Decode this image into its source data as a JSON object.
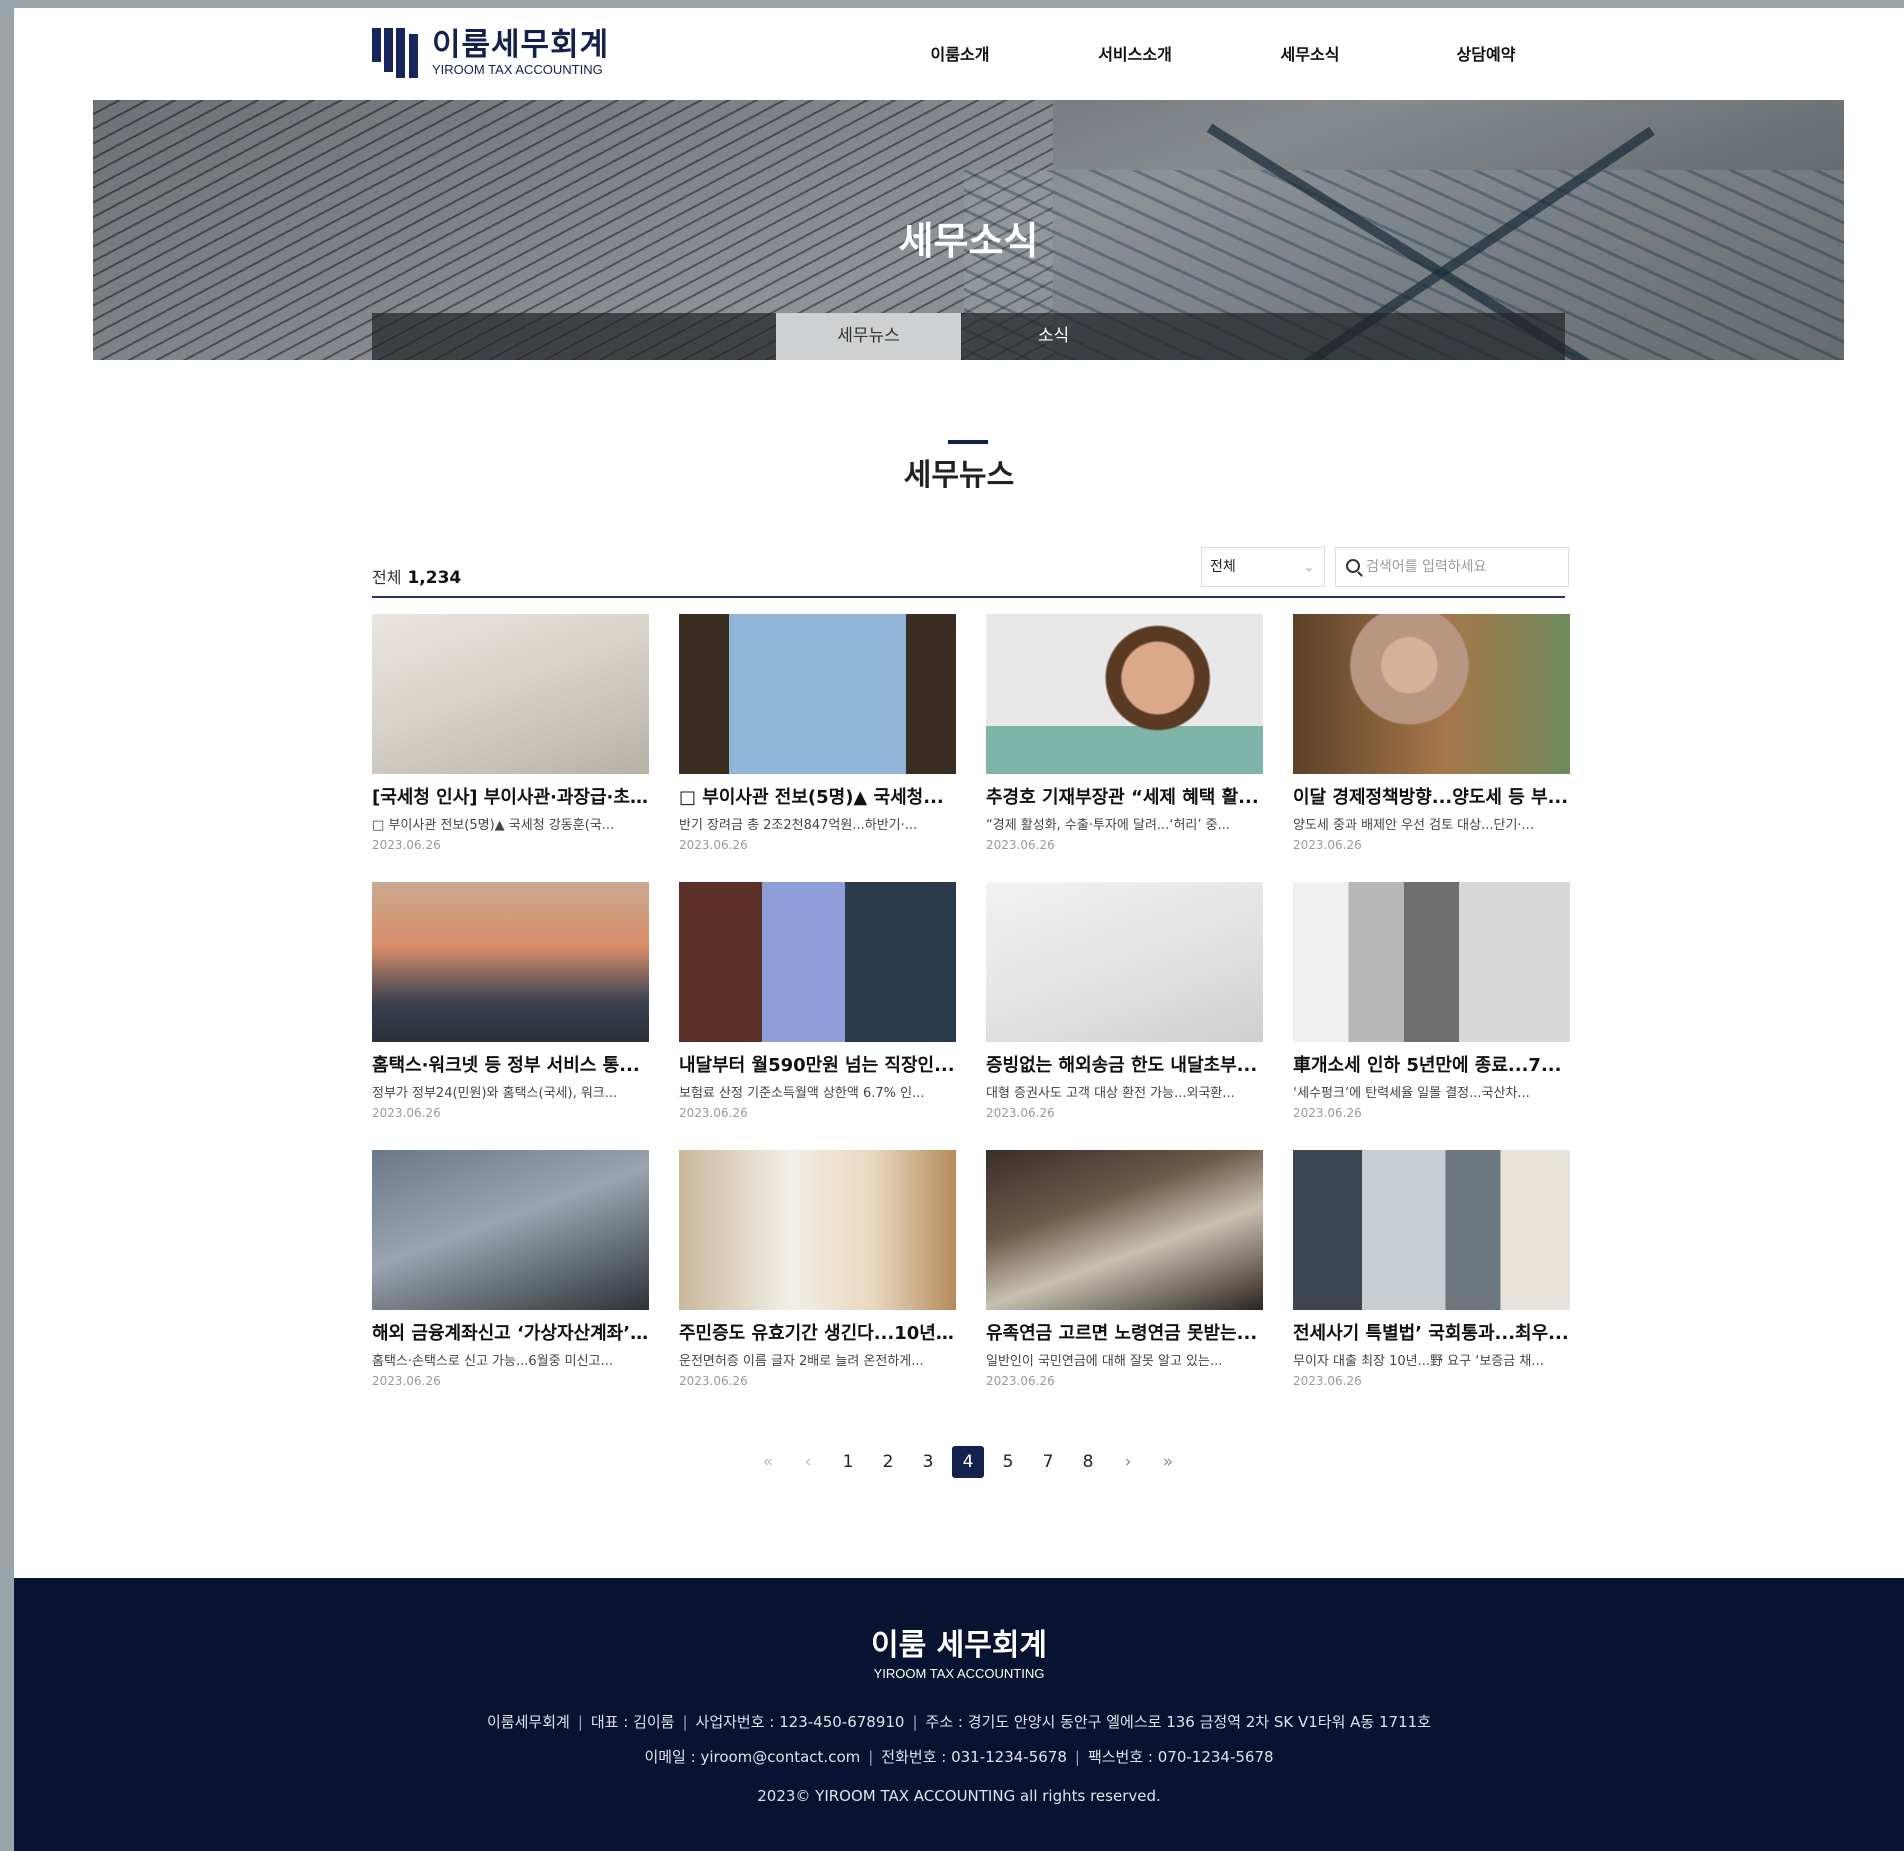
{
  "brand": {
    "name_ko": "이룸세무회계",
    "name_en": "YIROOM TAX ACCOUNTING",
    "color": "#15214d"
  },
  "nav": [
    "이룸소개",
    "서비스소개",
    "세무소식",
    "상담예약"
  ],
  "hero": {
    "title": "세무소식",
    "tabs": [
      {
        "label": "세무뉴스",
        "active": true
      },
      {
        "label": "소식",
        "active": false
      }
    ]
  },
  "section_title": "세무뉴스",
  "toolbar": {
    "total_label": "전체",
    "total_count": "1,234",
    "filter_selected": "전체",
    "search_placeholder": "검색어를 입력하세요"
  },
  "articles": [
    {
      "title": "[국세청 인사] 부이사관·과장급·초...",
      "summary": "□ 부이사관 전보(5명)▲ 국세청 강동훈(국...",
      "date": "2023.06.26",
      "image": "writing-desk"
    },
    {
      "title": "□ 부이사관 전보(5명)▲ 국세청...",
      "summary": "반기 장려금 총 2조2천847억원...하반기·...",
      "date": "2023.06.26",
      "image": "glass-towers-up"
    },
    {
      "title": "추경호 기재부장관 “세제 혜택 활...",
      "summary": "“경제 활성화, 수출·투자에 달려...‘허리’ 중...",
      "date": "2023.06.26",
      "image": "smiling-man"
    },
    {
      "title": "이달 경제정책방향...양도세 등 부...",
      "summary": "양도세 중과 배제안 우선 검토 대상...단기·...",
      "date": "2023.06.26",
      "image": "woman-laptop"
    },
    {
      "title": "홈택스·워크넷 등 정부 서비스 통...",
      "summary": "정부가 정부24(민원)와 홈택스(국세), 워크...",
      "date": "2023.06.26",
      "image": "laptop-website"
    },
    {
      "title": "내달부터 월590만원 넘는 직장인...",
      "summary": "보험료 산정 기준소득월액 상한액 6.7% 인...",
      "date": "2023.06.26",
      "image": "towers-dusk"
    },
    {
      "title": "증빙없는 해외송금 한도 내달초부...",
      "summary": "대형 증권사도 고객 대상 환전 가능...외국환...",
      "date": "2023.06.26",
      "image": "glasses-notebook"
    },
    {
      "title": "車개소세 인하 5년만에 종료...7...",
      "summary": "‘세수펑크’에 탄력세율 일몰 결정...국산차...",
      "date": "2023.06.26",
      "image": "office-people"
    },
    {
      "title": "해외 금융계좌신고 ‘가상자산계좌’...",
      "summary": "홈택스·손택스로 신고 가능...6월중 미신고...",
      "date": "2023.06.26",
      "image": "laptop-pointing"
    },
    {
      "title": "주민증도 유효기간 생긴다...10년...",
      "summary": "운전면허증 이름 글자 2배로 늘려 온전하게...",
      "date": "2023.06.26",
      "image": "man-phone"
    },
    {
      "title": "유족연금 고르면 노령연금 못받는...",
      "summary": "일반인이 국민연금에 대해 잘못 알고 있는...",
      "date": "2023.06.26",
      "image": "man-computer"
    },
    {
      "title": "전세사기 특별법’ 국회통과...최우...",
      "summary": "무이자 대출 최장 10년...野 요구 ‘보증금 채...",
      "date": "2023.06.26",
      "image": "city-skyline"
    }
  ],
  "pagination": {
    "first": "«",
    "prev": "‹",
    "pages": [
      "1",
      "2",
      "3",
      "4",
      "5",
      "7",
      "8"
    ],
    "current": "4",
    "next": "›",
    "last": "»"
  },
  "footer": {
    "logo_ko": "이룸 세무회계",
    "logo_en": "YIROOM TAX ACCOUNTING",
    "company": "이룸세무회계",
    "ceo": "대표 : 김이룸",
    "biz_no": "사업자번호 : 123-450-678910",
    "address": "주소 : 경기도 안양시 동안구 엘에스로 136 금정역 2차 SK V1타워 A동 1711호",
    "email": "이메일 : yiroom@contact.com",
    "tel": "전화번호 : 031-1234-5678",
    "fax": "팩스번호 : 070-1234-5678",
    "copyright": "2023© YIROOM TAX ACCOUNTING all rights reserved."
  }
}
